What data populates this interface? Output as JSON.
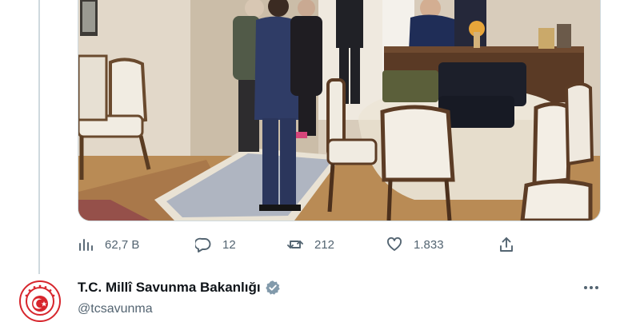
{
  "tweet_actions": {
    "views": "62,7 B",
    "replies": "12",
    "retweets": "212",
    "likes": "1.833"
  },
  "next_tweet": {
    "display_name": "T.C. Millî Savunma Bakanlığı",
    "handle": "@tcsavunma",
    "verified": true
  },
  "colors": {
    "icon_gray": "#536471",
    "verified_badge": "#829aab",
    "avatar_ring": "#d7262d"
  },
  "icons": [
    "analytics-icon",
    "reply-icon",
    "retweet-icon",
    "like-icon",
    "share-icon",
    "more-icon",
    "verified-icon"
  ]
}
